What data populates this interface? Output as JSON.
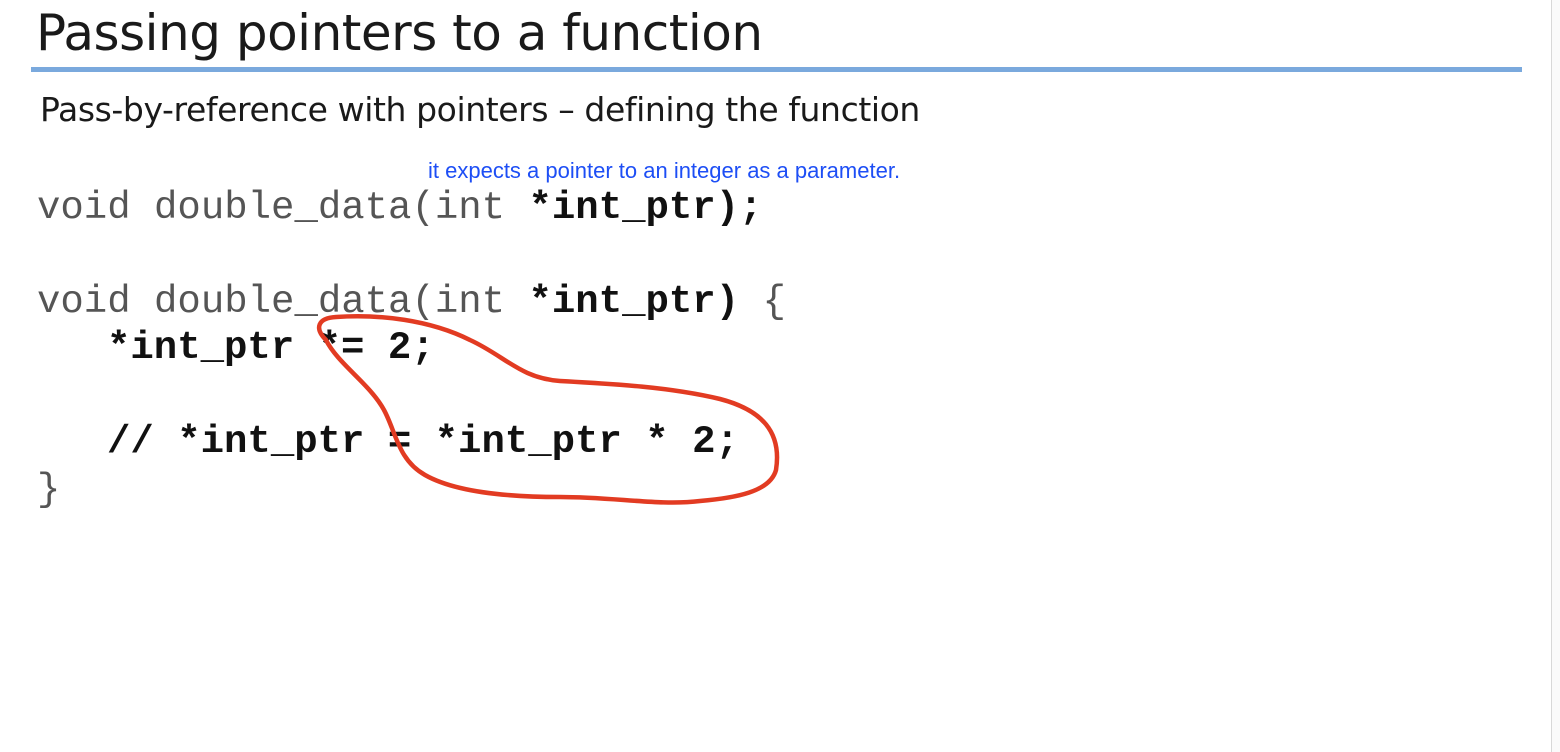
{
  "slide": {
    "title": "Passing pointers to a function",
    "subtitle": "Pass-by-reference with pointers – defining the function",
    "annotation": "it expects a pointer to an integer as a parameter.",
    "accent_color": "#7aa9dd",
    "annotation_color": "#1d4ef5",
    "ink_color": "#e23b22"
  },
  "code": {
    "proto_prefix": "void double_data(int ",
    "proto_bold": "*int_ptr);",
    "def_prefix": "void double_data(int ",
    "def_bold": "*int_ptr)",
    "def_suffix": " {",
    "stmt_bold": "*int_ptr *= 2;",
    "comment_bold": "// *int_ptr = *int_ptr * 2;",
    "close_brace": "}"
  },
  "drawing": {
    "shape": "hand-drawn red loop around the *= 2 statement and commented equivalent"
  }
}
